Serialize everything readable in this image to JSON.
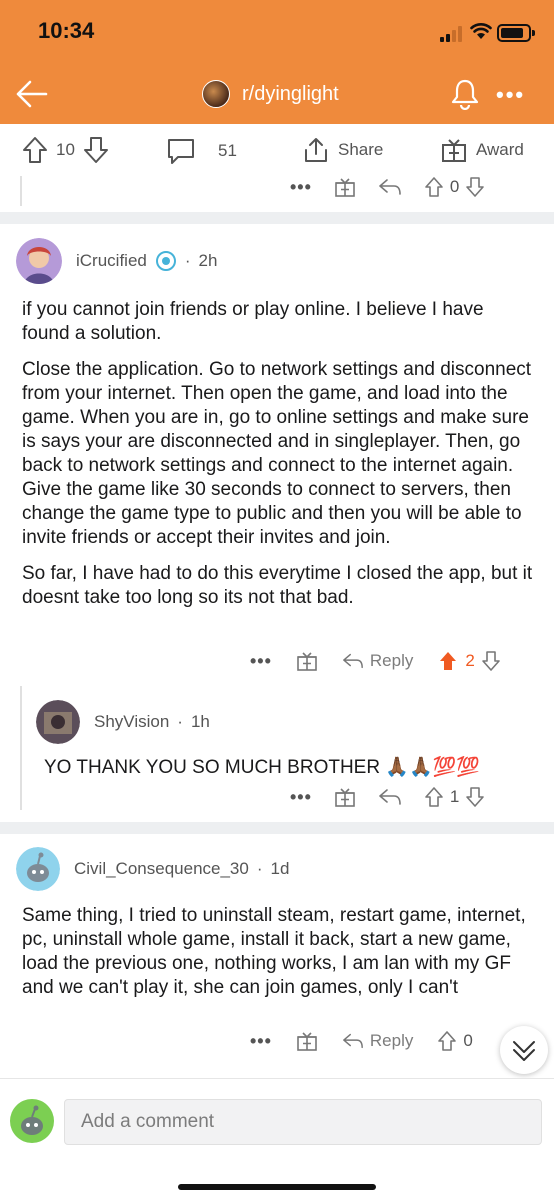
{
  "status": {
    "time": "10:34"
  },
  "header": {
    "subreddit": "r/dyinglight"
  },
  "post_actions": {
    "votes": "10",
    "comments": "51",
    "share_label": "Share",
    "award_label": "Award"
  },
  "thread0": {
    "votes": "0"
  },
  "comments": [
    {
      "author": "iCrucified",
      "age": "2h",
      "paragraphs": [
        "if you cannot join friends or play online. I believe I have found a solution.",
        "Close the application. Go to network settings and disconnect from your internet. Then open the game, and load into the game. When you are in, go to online settings and make sure is says your are disconnected and in singleplayer. Then, go back to network settings and connect to the internet again. Give the game like 30 seconds to connect to servers, then change the game type to public and then you will be able to invite friends or accept their invites and join.",
        "So far, I have had to do this everytime I closed the app, but it doesnt take too long so its not that bad."
      ],
      "reply_label": "Reply",
      "votes": "2",
      "upvote_color": "#f05a22"
    },
    {
      "author": "ShyVision",
      "age": "1h",
      "text": "YO THANK YOU SO MUCH BROTHER 🙏🏾🙏🏾💯💯",
      "votes": "1"
    },
    {
      "author": "Civil_Consequence_30",
      "age": "1d",
      "text": "Same thing, I tried to uninstall steam, restart game, internet, pc, uninstall whole game, install it back, start a new game, load the previous one, nothing works, I am lan with my GF and we can't play it, she can join games, only I can't",
      "reply_label": "Reply",
      "votes": "0"
    }
  ],
  "composer": {
    "placeholder": "Add a comment"
  },
  "colors": {
    "brand": "#ef8a3c",
    "upvoted": "#f05a22"
  },
  "icons": [
    "back-arrow-icon",
    "bell-icon",
    "more-icon",
    "upvote-icon",
    "downvote-icon",
    "comment-icon",
    "share-icon",
    "gift-icon",
    "reply-icon",
    "chevron-double-down-icon"
  ]
}
